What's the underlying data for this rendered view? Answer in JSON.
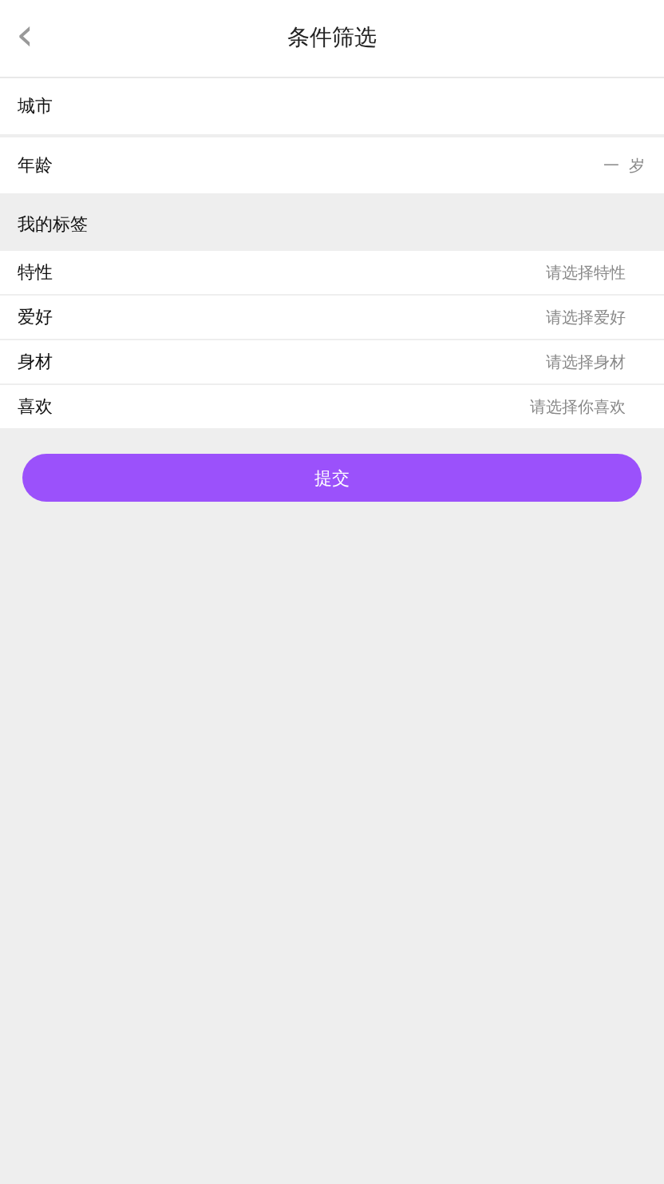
{
  "header": {
    "back_icon": "‹",
    "title": "条件筛选"
  },
  "basic_rows": [
    {
      "label": "城市"
    },
    {
      "label": "年龄",
      "value": "一",
      "unit": "岁"
    }
  ],
  "section_title": "我的标签",
  "tag_rows": [
    {
      "label": "特性",
      "placeholder": "请选择特性"
    },
    {
      "label": "爱好",
      "placeholder": "请选择爱好"
    },
    {
      "label": "身材",
      "placeholder": "请选择身材"
    },
    {
      "label": "喜欢",
      "placeholder": "请选择你喜欢"
    }
  ],
  "submit_button": "提交"
}
